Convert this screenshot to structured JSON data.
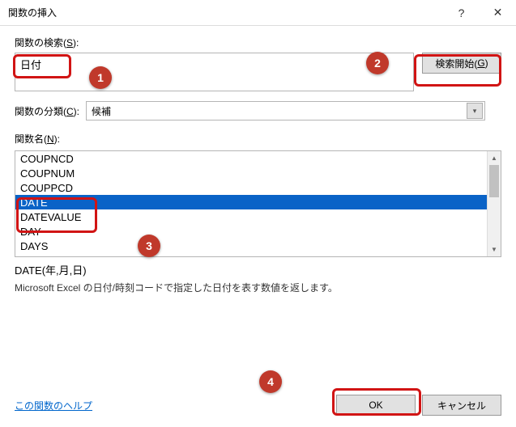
{
  "titlebar": {
    "title": "関数の挿入"
  },
  "search": {
    "label_prefix": "関数の検索(",
    "label_key": "S",
    "label_suffix": "):",
    "value": "日付",
    "button_prefix": "検索開始(",
    "button_key": "G",
    "button_suffix": ")"
  },
  "category": {
    "label_prefix": "関数の分類(",
    "label_key": "C",
    "label_suffix": "):",
    "selected": "候補"
  },
  "funclist": {
    "label_prefix": "関数名(",
    "label_key": "N",
    "label_suffix": "):",
    "items": [
      "COUPNCD",
      "COUPNUM",
      "COUPPCD",
      "DATE",
      "DATEVALUE",
      "DAY",
      "DAYS"
    ],
    "selected_index": 3
  },
  "description": {
    "signature": "DATE(年,月,日)",
    "text": "Microsoft Excel の日付/時刻コードで指定した日付を表す数値を返します。"
  },
  "footer": {
    "help_link": "この関数のヘルプ",
    "ok": "OK",
    "cancel": "キャンセル"
  },
  "badges": {
    "b1": "1",
    "b2": "2",
    "b3": "3",
    "b4": "4"
  }
}
